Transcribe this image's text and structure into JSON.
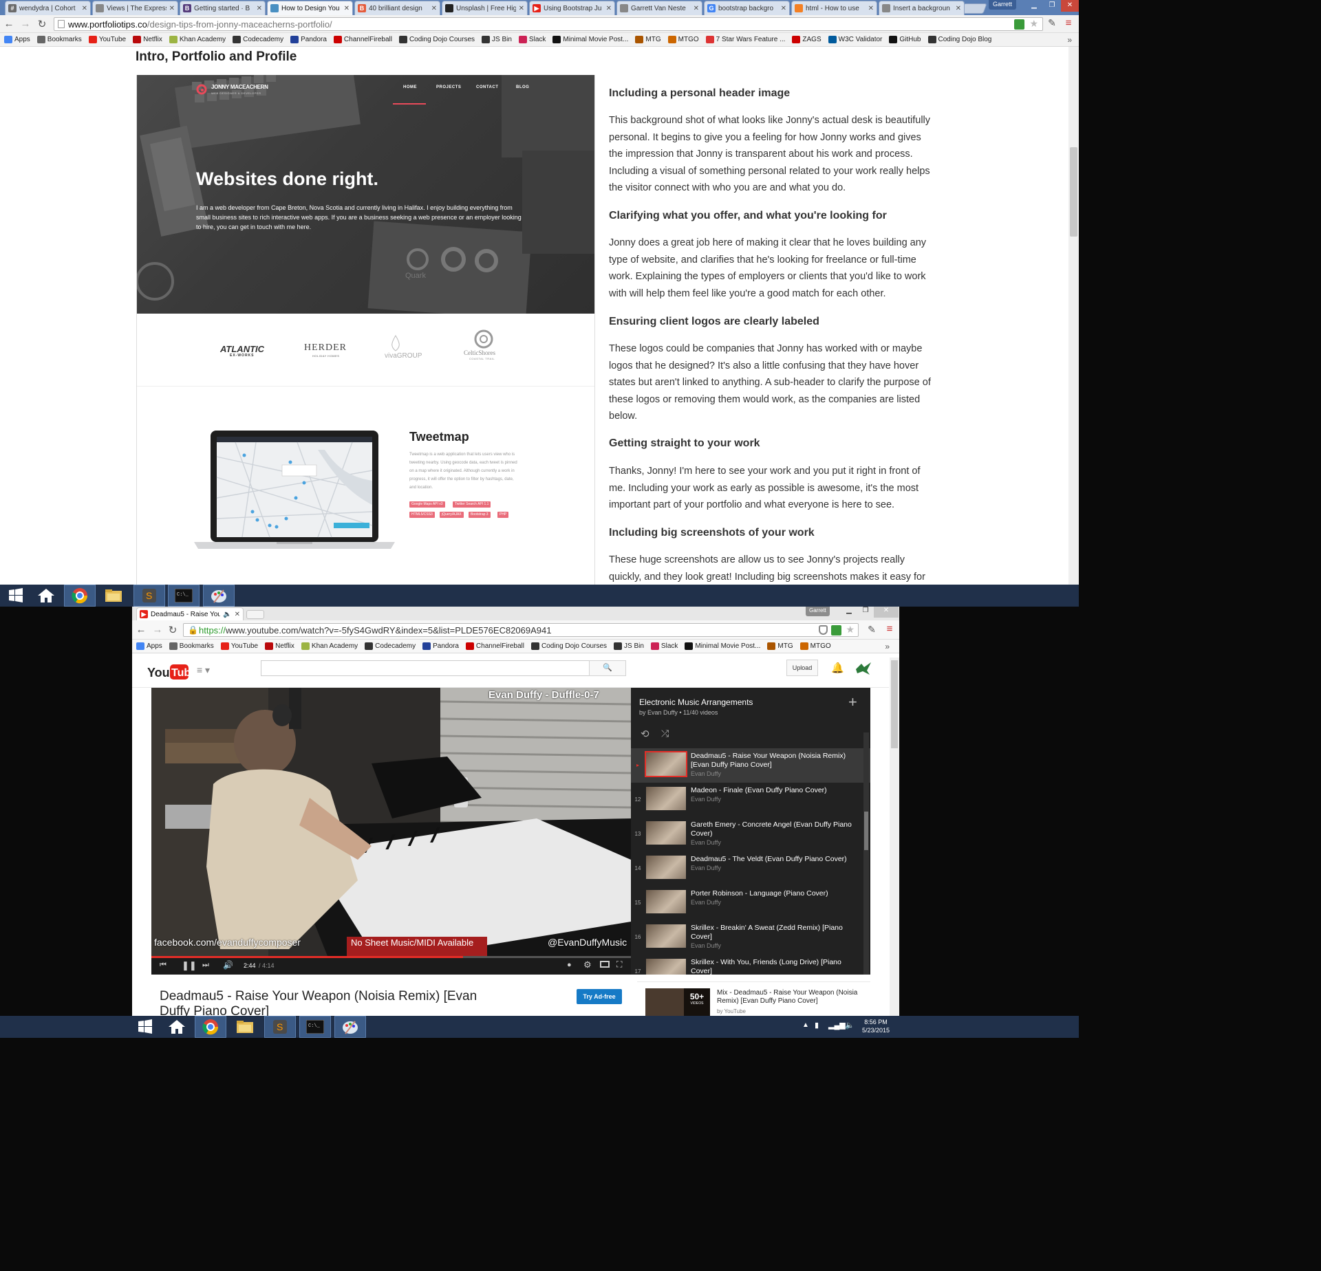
{
  "top_window": {
    "tabs": [
      {
        "label": "wendydra | Cohort",
        "color": "#6b6b6b",
        "glyph": "#"
      },
      {
        "label": "Views | The Express",
        "color": "#888888",
        "glyph": ""
      },
      {
        "label": "Getting started · B",
        "color": "#563d7c",
        "glyph": "B"
      },
      {
        "label": "How to Design You",
        "color": "#4a90c2",
        "glyph": ""
      },
      {
        "label": "40 brilliant design",
        "color": "#e45b3b",
        "glyph": "B"
      },
      {
        "label": "Unsplash | Free Hig",
        "color": "#222222",
        "glyph": ""
      },
      {
        "label": "Using Bootstrap Ju",
        "color": "#e62117",
        "glyph": "▶"
      },
      {
        "label": "Garrett Van Neste",
        "color": "#888888",
        "glyph": ""
      },
      {
        "label": "bootstrap backgro",
        "color": "#4285f4",
        "glyph": "G"
      },
      {
        "label": "html - How to use",
        "color": "#f48024",
        "glyph": ""
      },
      {
        "label": "Insert a backgroun",
        "color": "#888888",
        "glyph": ""
      }
    ],
    "user_badge": "Garrett",
    "url_host": "www.portfoliotips.co",
    "url_path": "/design-tips-from-jonny-maceacherns-portfolio/",
    "bookmarks": [
      {
        "label": "Apps",
        "icon": "apps-icon",
        "color": "#4285f4"
      },
      {
        "label": "Bookmarks",
        "icon": "star-icon",
        "color": "#666666"
      },
      {
        "label": "YouTube",
        "icon": "youtube-icon",
        "color": "#e62117"
      },
      {
        "label": "Netflix",
        "icon": "netflix-icon",
        "color": "#b9090b"
      },
      {
        "label": "Khan Academy",
        "icon": "khan-icon",
        "color": "#9cb443"
      },
      {
        "label": "Codecademy",
        "icon": "codecademy-icon",
        "color": "#333333"
      },
      {
        "label": "Pandora",
        "icon": "pandora-icon",
        "color": "#224099"
      },
      {
        "label": "ChannelFireball",
        "icon": "channelfireball-icon",
        "color": "#cc0000"
      },
      {
        "label": "Coding Dojo Courses",
        "icon": "dojo-icon",
        "color": "#333333"
      },
      {
        "label": "JS Bin",
        "icon": "jsbin-icon",
        "color": "#333333"
      },
      {
        "label": "Slack",
        "icon": "slack-icon",
        "color": "#cc2255"
      },
      {
        "label": "Minimal Movie Post...",
        "icon": "movie-icon",
        "color": "#111111"
      },
      {
        "label": "MTG",
        "icon": "mtg-icon",
        "color": "#aa5500"
      },
      {
        "label": "MTGO",
        "icon": "mtgo-icon",
        "color": "#cc6600"
      },
      {
        "label": "7 Star Wars Feature ...",
        "icon": "starwars-icon",
        "color": "#dd3333"
      },
      {
        "label": "ZAGS",
        "icon": "zags-icon",
        "color": "#cc0000"
      },
      {
        "label": "W3C Validator",
        "icon": "w3c-icon",
        "color": "#005a9c"
      },
      {
        "label": "GitHub",
        "icon": "github-icon",
        "color": "#111111"
      },
      {
        "label": "Coding Dojo Blog",
        "icon": "dojo-blog-icon",
        "color": "#333333"
      }
    ]
  },
  "article": {
    "section_title": "Intro, Portfolio and Profile",
    "screenshot": {
      "logo_name": "JONNY MACEACHERN",
      "logo_sub": "WEB DESIGNER & DEVELOPER",
      "nav": [
        "HOME",
        "PROJECTS",
        "CONTACT",
        "BLOG"
      ],
      "hero_title": "Websites done right.",
      "hero_text": "I am a web developer from Cape Breton, Nova Scotia and currently living in Halifax. I enjoy building everything from small business sites to rich interactive web apps. If you are a business seeking a web presence or an employer looking to hire, you can get in touch with me here.",
      "client_logos": [
        "ATLANTIC",
        "EX-WORKS",
        "HERDER",
        "HOLIDAY HOMES",
        "vivaGROUP",
        "CelticShores",
        "COASTAL TRAIL"
      ],
      "project_title": "Tweetmap",
      "project_desc": "Tweetmap is a web application that lets users view who is tweeting nearby. Using geocode data, each tweet is pinned on a map where it originated. Although currently a work in progress, it will offer the option to filter by hashtags, date, and location.",
      "project_tags": [
        "Google Maps API v3",
        "Twitter Search API 1.1",
        "HTML5/CSS3",
        "jQuery/AJAX",
        "Bootstrap 3",
        "PHP"
      ],
      "accent": "#e94a5a"
    },
    "sections": [
      {
        "heading": "Including a personal header image",
        "body": "This background shot of what looks like Jonny's actual desk is beautifully personal. It begins to give you a feeling for how Jonny works and gives the impression that Jonny is transparent about his work and process. Including a visual of something personal related to your work really helps the visitor connect with who you are and what you do."
      },
      {
        "heading": "Clarifying what you offer, and what you're looking for",
        "body": "Jonny does a great job here of making it clear that he loves building any type of website, and clarifies that he's looking for freelance or full-time work. Explaining the types of employers or clients that you'd like to work with will help them feel like you're a good match for each other."
      },
      {
        "heading": "Ensuring client logos are clearly labeled",
        "body": "These logos could be companies that Jonny has worked with or maybe logos that he designed? It's also a little confusing that they have hover states but aren't linked to anything. A sub-header to clarify the purpose of these logos or removing them would work, as the companies are listed below."
      },
      {
        "heading": "Getting straight to your work",
        "body": "Thanks, Jonny! I'm here to see your work and you put it right in front of me. Including your work as early as possible is awesome, it's the most important part of your portfolio and what everyone is here to see."
      },
      {
        "heading": "Including big screenshots of your work",
        "body": "These huge screenshots are allow us to see Jonny's projects really quickly, and they look great! Including big screenshots makes it easy for"
      }
    ]
  },
  "bottom_window": {
    "tab_title": "Deadmau5 - Raise You",
    "user_badge": "Garrett",
    "url_scheme": "https://",
    "url_rest": "www.youtube.com/watch?v=-5fyS4GwdRY&index=5&list=PLDE576EC82069A941",
    "bookmarks": [
      "Apps",
      "Bookmarks",
      "YouTube",
      "Netflix",
      "Khan Academy",
      "Codecademy",
      "Pandora",
      "ChannelFireball",
      "Coding Dojo Courses",
      "JS Bin",
      "Slack",
      "Minimal Movie Post...",
      "MTG",
      "MTGO"
    ],
    "upload_label": "Upload",
    "video": {
      "overlay_title": "Evan Duffy - Duffle-0-7",
      "overlay_left": "facebook.com/evanduffycomposer",
      "overlay_middle": "No Sheet Music/MIDI Available",
      "overlay_right": "@EvanDuffyMusic",
      "time_current": "2:44",
      "time_total": "/ 4:14",
      "progress": 0.65
    },
    "playlist": {
      "title": "Electronic Music Arrangements",
      "meta": "by Evan Duffy • 11/40 videos",
      "items": [
        {
          "num": "▸",
          "title": "Deadmau5 - Raise Your Weapon (Noisia Remix) [Evan Duffy Piano Cover]",
          "by": "Evan Duffy",
          "active": true
        },
        {
          "num": "12",
          "title": "Madeon - Finale (Evan Duffy Piano Cover)",
          "by": "Evan Duffy"
        },
        {
          "num": "13",
          "title": "Gareth Emery - Concrete Angel (Evan Duffy Piano Cover)",
          "by": "Evan Duffy"
        },
        {
          "num": "14",
          "title": "Deadmau5 - The Veldt (Evan Duffy Piano Cover)",
          "by": "Evan Duffy"
        },
        {
          "num": "15",
          "title": "Porter Robinson - Language (Piano Cover)",
          "by": "Evan Duffy"
        },
        {
          "num": "16",
          "title": "Skrillex - Breakin' A Sweat (Zedd Remix) [Piano Cover]",
          "by": "Evan Duffy"
        },
        {
          "num": "17",
          "title": "Skrillex - With You, Friends (Long Drive) [Piano Cover]",
          "by": "Evan Duffy"
        }
      ]
    },
    "video_title": "Deadmau5 - Raise Your Weapon (Noisia Remix) [Evan Duffy Piano Cover]",
    "ad_free_label": "Try Ad-free",
    "mix": {
      "count": "50+",
      "count_label": "VIDEOS",
      "title": "Mix - Deadmau5 - Raise Your Weapon (Noisia Remix) [Evan Duffy Piano Cover]",
      "by": "by YouTube"
    }
  },
  "taskbar": {
    "clock_time": "8:56 PM",
    "clock_date": "5/23/2015"
  }
}
